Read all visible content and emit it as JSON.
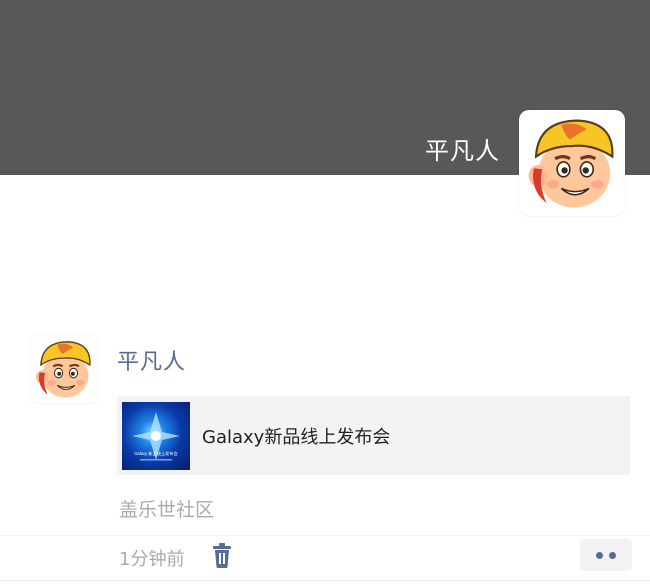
{
  "cover": {
    "username": "平凡人",
    "background_color": "#585858"
  },
  "post": {
    "author": "平凡人",
    "link_card": {
      "title": "Galaxy新品线上发布会",
      "thumbnail_text": "Galaxy 新品线上发布会"
    },
    "source": "盖乐世社区",
    "time": "1分钟前",
    "icons": {
      "delete": "trash-icon",
      "more": "more-dots-icon"
    }
  },
  "colors": {
    "author_link": "#576b95",
    "meta_text": "#aaaaaa"
  }
}
